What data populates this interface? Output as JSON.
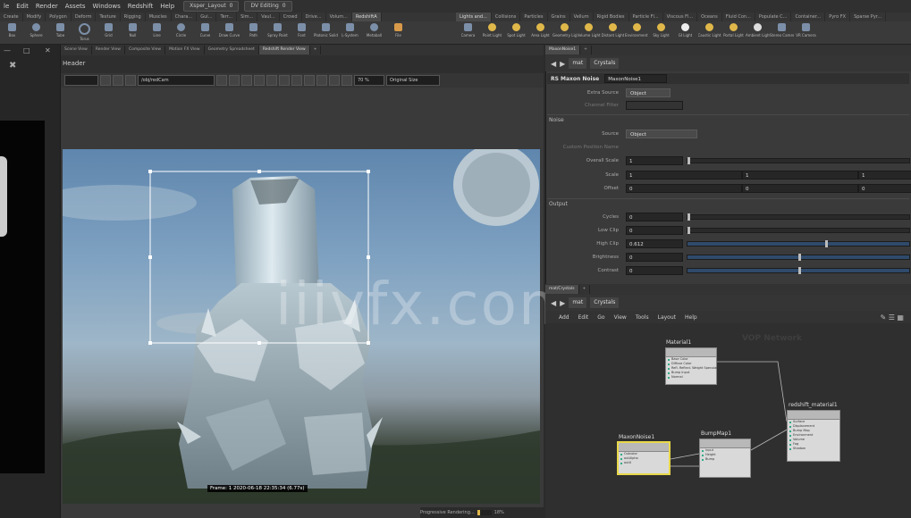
{
  "menubar": {
    "items": [
      "le",
      "Edit",
      "Render",
      "Assets",
      "Windows",
      "Redshift",
      "Help"
    ],
    "desktop": "Xsper_Layout",
    "desktop_num": "0",
    "mode": "DV Editing",
    "mode_num": "0"
  },
  "shelf": {
    "left_tabs": [
      "Create",
      "Modify",
      "Polygon",
      "Deform",
      "Texture",
      "Rigging",
      "Muscles",
      "Chara...",
      "Gui...",
      "Terr...",
      "Sim...",
      "Vaul...",
      "Crowd",
      "Drive...",
      "Volum...",
      "RedshiftA"
    ],
    "right_tabs": [
      "Lights and...",
      "Collisions",
      "Particles",
      "Grains",
      "Vellum",
      "Rigid Bodies",
      "Particle Fl...",
      "Viscous Fl...",
      "Oceans",
      "Fluid Con...",
      "Populate C...",
      "Container...",
      "Pyro FX",
      "Sparse Pyr..."
    ],
    "left_tools": [
      "Box",
      "Sphere",
      "Tube",
      "Torus",
      "Grid",
      "Null",
      "Line",
      "Circle",
      "Curve",
      "Draw Curve",
      "Path",
      "Spray Paint",
      "Font",
      "Platonic Solids",
      "L-System",
      "Metaball",
      "File"
    ],
    "right_tools": [
      "Camera",
      "Point Light",
      "Spot Light",
      "Area Light",
      "Geometry Light",
      "Volume Light",
      "Distant Light",
      "Environment Light",
      "Sky Light",
      "GI Light",
      "Caustic Light",
      "Portal Light",
      "Ambient Light",
      "Stereo Camera",
      "VR Camera"
    ]
  },
  "viewer": {
    "tabs": [
      "Scene View",
      "Render View",
      "Composite View",
      "Motion FX View",
      "Geometry Spreadsheet",
      "Redshift Render View"
    ],
    "header": "Header",
    "camera": "/obj/redCam",
    "zoom": "70 %",
    "size_mode": "Original Size",
    "frame_label": "Frame: 1   2020-06-18  22:35:34  (6.77s)",
    "progress_label": "Progressive Rendering...",
    "progress_pct": "18%",
    "progress_value": 0.18
  },
  "params": {
    "tabs": [
      "MaxonNoise1",
      "+"
    ],
    "path_obj": "mat",
    "path_node": "Crystals",
    "node_type": "RS Maxon Noise",
    "node_name": "MaxonNoise1",
    "extra_source_label": "Extra Source",
    "extra_source_value": "Object",
    "channel_label": "Channel Filter",
    "section_noise": "Noise",
    "source_label": "Source",
    "source_value": "Object",
    "custom_pos_label": "Custom Position Name",
    "overall_scale_label": "Overall Scale",
    "overall_scale_value": "1",
    "scale_label": "Scale",
    "scale_values": [
      "1",
      "1",
      "1"
    ],
    "offset_label": "Offset",
    "offset_values": [
      "0",
      "0",
      "0"
    ],
    "section_output": "Output",
    "cycles_label": "Cycles",
    "cycles_value": "0",
    "lowclip_label": "Low Clip",
    "lowclip_value": "0",
    "highclip_label": "High Clip",
    "highclip_value": "0.612",
    "brightness_label": "Brightness",
    "brightness_value": "0",
    "contrast_label": "Contrast",
    "contrast_value": "0",
    "high_clip_fraction": 0.62,
    "brightness_fraction": 0.5,
    "contrast_fraction": 0.5
  },
  "network": {
    "tabs": [
      "mat/Crystals",
      "+"
    ],
    "path_obj": "mat",
    "path_node": "Crystals",
    "menu": [
      "Add",
      "Edit",
      "Go",
      "View",
      "Tools",
      "Layout",
      "Help"
    ],
    "bg_label": "VOP Network",
    "nodes": {
      "material1": {
        "name": "Material1",
        "ports": [
          "Base Color",
          "Diffuse Color",
          "Refl. Reflect. Weight Specular",
          "Bump Input",
          "Normal"
        ]
      },
      "noise": {
        "name": "MaxonNoise1",
        "ports": [
          "Outcolor",
          "outAlpha",
          "outX"
        ]
      },
      "bump": {
        "name": "BumpMap1",
        "ports": [
          "input",
          "Height",
          "Bump"
        ]
      },
      "rs_material": {
        "name": "redshift_material1",
        "ports": [
          "Surface",
          "Displacement",
          "Bump Map",
          "Environment",
          "Volume",
          "Fog",
          "Shadow"
        ]
      }
    }
  },
  "watermark": "iiivfx.com"
}
